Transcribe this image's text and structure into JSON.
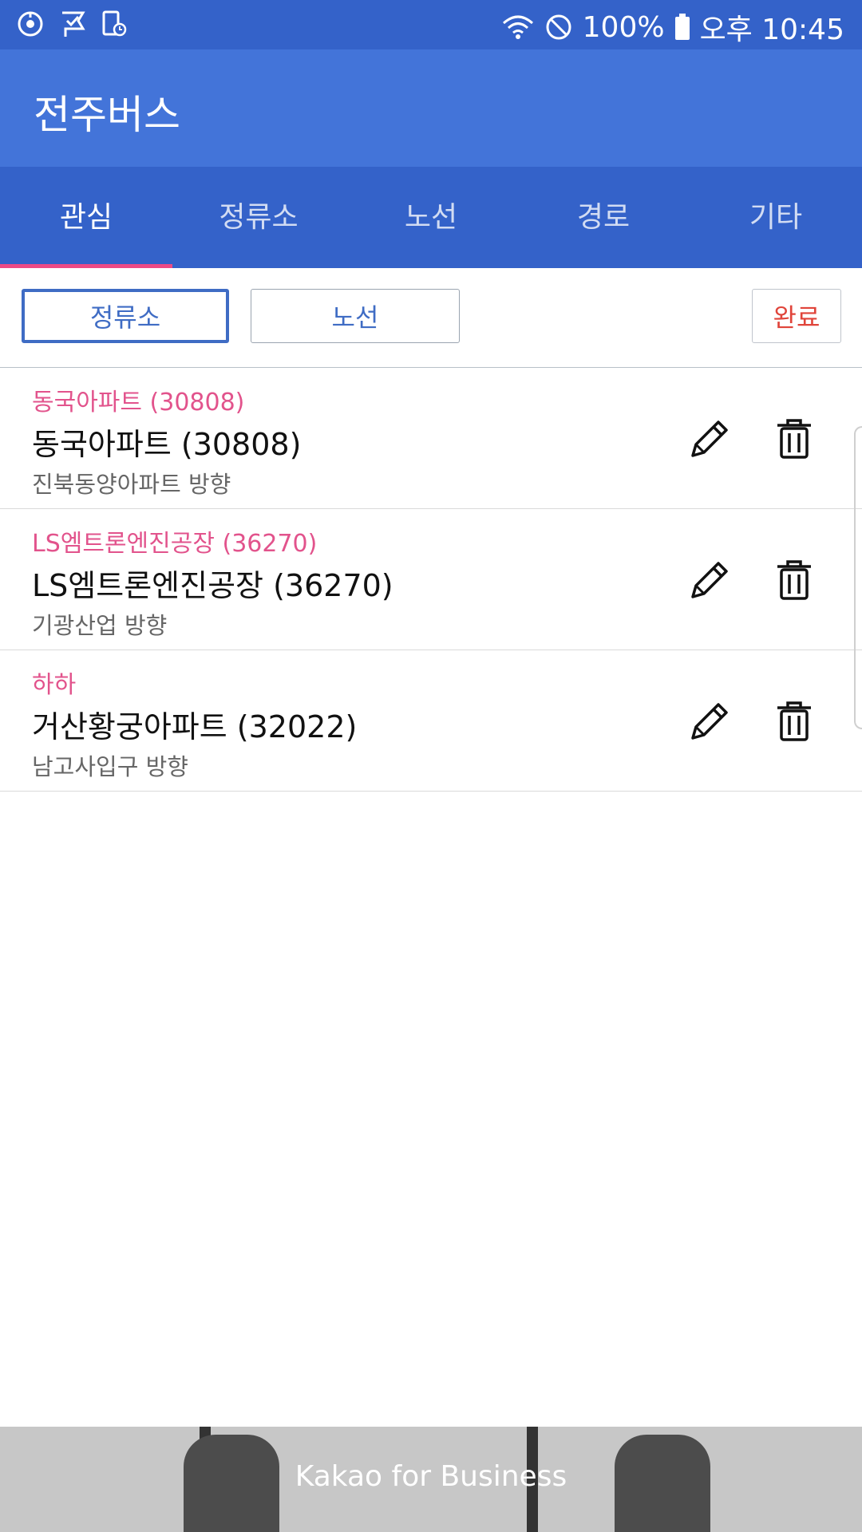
{
  "status_bar": {
    "left_icons": [
      "sync-icon",
      "check-flag-icon",
      "phone-clock-icon"
    ],
    "battery": "100%",
    "time": "오후 10:45"
  },
  "app": {
    "title": "전주버스"
  },
  "tabs": [
    {
      "label": "관심",
      "active": true
    },
    {
      "label": "정류소",
      "active": false
    },
    {
      "label": "노선",
      "active": false
    },
    {
      "label": "경로",
      "active": false
    },
    {
      "label": "기타",
      "active": false
    }
  ],
  "toolbar": {
    "stop_label": "정류소",
    "route_label": "노선",
    "done_label": "완료"
  },
  "favorites": [
    {
      "alias": "동국아파트 (30808)",
      "name": "동국아파트 (30808)",
      "direction": "진북동양아파트 방향"
    },
    {
      "alias": "LS엠트론엔진공장 (36270)",
      "name": "LS엠트론엔진공장 (36270)",
      "direction": "기광산업 방향"
    },
    {
      "alias": "하하",
      "name": "거산황궁아파트 (32022)",
      "direction": "남고사입구 방향"
    }
  ],
  "ad": {
    "text": "Kakao for Business"
  },
  "colors": {
    "status_bar": "#3462c9",
    "app_bar": "#4374d9",
    "tab_indicator": "#ec4a86",
    "alias_text": "#e2538c",
    "done_text": "#e0443a"
  }
}
